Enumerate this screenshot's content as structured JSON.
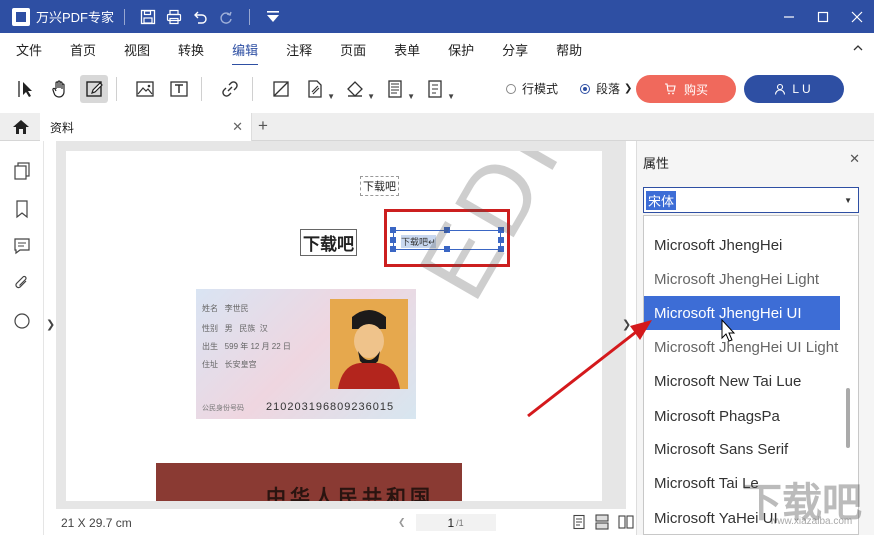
{
  "titlebar": {
    "app_title": "万兴PDF专家"
  },
  "menu": {
    "items": [
      "文件",
      "首页",
      "视图",
      "转换",
      "编辑",
      "注释",
      "页面",
      "表单",
      "保护",
      "分享",
      "帮助"
    ],
    "active_index": 4
  },
  "toolbar": {
    "radio_line_mode": "行模式",
    "radio_para_mode": "段落",
    "buy_label": "购买",
    "user_label": "LU"
  },
  "tabs": {
    "doc_tab": "资料"
  },
  "document": {
    "text_small": "下载吧",
    "text_big": "下载吧",
    "edit_text": "下载吧↵",
    "id_card": {
      "name_label": "姓名",
      "name_value": "李世民",
      "gender_label": "性别",
      "gender_value": "男",
      "ethnic_label": "民族",
      "ethnic_value": "汉",
      "birth_label": "出生",
      "birth_value": "599 年 12 月 22 日",
      "address_label": "住址",
      "address_value": "长安皇宫",
      "number_label": "公民身份号码",
      "number": "210203196809236015"
    },
    "card2_text": "中华人民共和国",
    "watermark": "EDITOR"
  },
  "statusbar": {
    "page_size": "21 X 29.7 cm",
    "page_current": "1",
    "page_total": "/1"
  },
  "properties": {
    "title": "属性",
    "font_value": "宋体",
    "font_list": [
      "Microsoft JhengHei",
      "Microsoft JhengHei Light",
      "Microsoft JhengHei UI",
      "Microsoft JhengHei UI Light",
      "Microsoft New Tai Lue",
      "Microsoft PhagsPa",
      "Microsoft Sans Serif",
      "Microsoft Tai Le",
      "Microsoft YaHei UI"
    ],
    "highlighted_index": 2
  },
  "watermark_site": {
    "mark": "下载吧",
    "url": "www.xiazaiba.com"
  },
  "colors": {
    "brand": "#2e4fa3",
    "buy": "#f0695c",
    "highlight": "#3d6dd6",
    "annotation_red": "#cc1f1f"
  }
}
